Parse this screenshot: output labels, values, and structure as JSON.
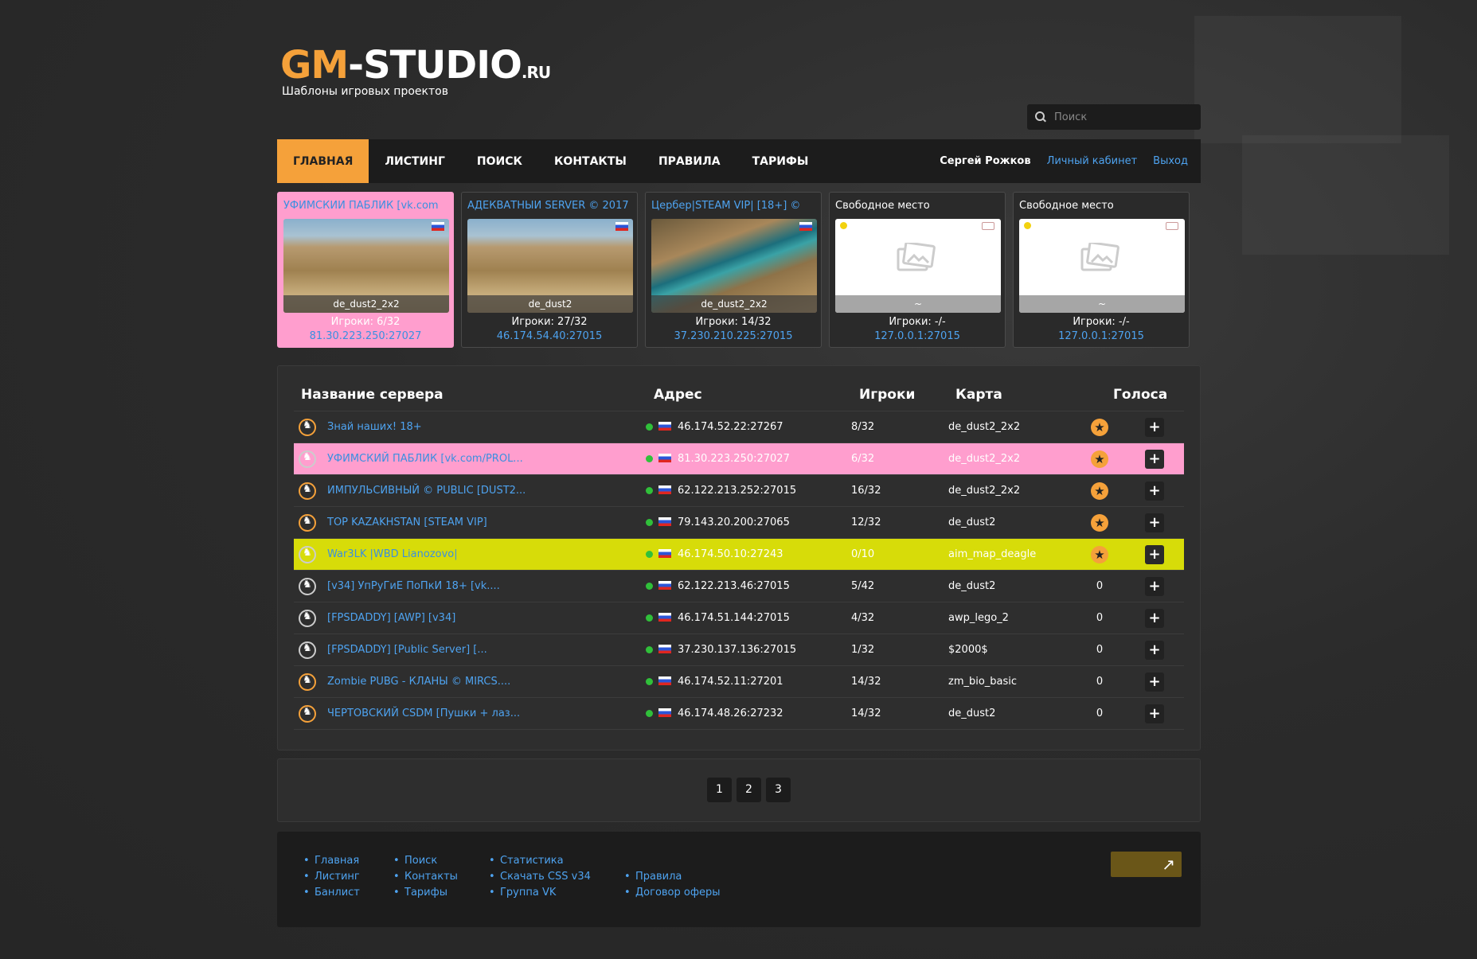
{
  "brand": {
    "logo_gm": "GM",
    "logo_studio": "-STUDIO",
    "logo_ru": ".RU",
    "tagline": "Шаблоны игровых проектов"
  },
  "search": {
    "placeholder": "Поиск"
  },
  "nav": {
    "items": [
      "ГЛАВНАЯ",
      "ЛИСТИНГ",
      "ПОИСК",
      "КОНТАКТЫ",
      "ПРАВИЛА",
      "ТАРИФЫ"
    ],
    "user": "Сергей Рожков",
    "cabinet": "Личный кабинет",
    "logout": "Выход"
  },
  "cards": [
    {
      "title": "УФИМСКИЙ ПАБЛИК [vk.com",
      "map": "de_dust2_2x2",
      "players": "Игроки: 6/32",
      "addr": "81.30.223.250:27027"
    },
    {
      "title": "АДЕКВАТНЫЙ SERVER © 2017",
      "map": "de_dust2",
      "players": "Игроки: 27/32",
      "addr": "46.174.54.40:27015"
    },
    {
      "title": "Цербер|STEAM VIP| [18+] ©",
      "map": "de_dust2_2x2",
      "players": "Игроки: 14/32",
      "addr": "37.230.210.225:27015"
    },
    {
      "title": "Свободное место",
      "map": "~",
      "players": "Игроки: -/-",
      "addr": "127.0.0.1:27015"
    },
    {
      "title": "Свободное место",
      "map": "~",
      "players": "Игроки: -/-",
      "addr": "127.0.0.1:27015"
    }
  ],
  "table": {
    "headers": {
      "name": "Название сервера",
      "addr": "Адрес",
      "players": "Игроки",
      "map": "Карта",
      "votes": "Голоса"
    },
    "rows": [
      {
        "name": "Знай наших! 18+",
        "addr": "46.174.52.22:27267",
        "players": "8/32",
        "map": "de_dust2_2x2",
        "votes": ""
      },
      {
        "name": "УФИМСКИЙ ПАБЛИК [vk.com/PROL...",
        "addr": "81.30.223.250:27027",
        "players": "6/32",
        "map": "de_dust2_2x2",
        "votes": ""
      },
      {
        "name": "ИМПУЛЬСИВНЫЙ © PUBLIC [DUST2...",
        "addr": "62.122.213.252:27015",
        "players": "16/32",
        "map": "de_dust2_2x2",
        "votes": ""
      },
      {
        "name": "TOP KAZAKHSTAN [STEAM VIP]",
        "addr": "79.143.20.200:27065",
        "players": "12/32",
        "map": "de_dust2",
        "votes": ""
      },
      {
        "name": "War3LK |WBD Lianozovo|",
        "addr": "46.174.50.10:27243",
        "players": "0/10",
        "map": "aim_map_deagle",
        "votes": ""
      },
      {
        "name": "[v34] УпРуГиЕ ПоПкИ 18+ [vk....",
        "addr": "62.122.213.46:27015",
        "players": "5/42",
        "map": "de_dust2",
        "votes": "0"
      },
      {
        "name": "[FPSDADDY] [AWP] [v34]",
        "addr": "46.174.51.144:27015",
        "players": "4/32",
        "map": "awp_lego_2",
        "votes": "0"
      },
      {
        "name": "[FPSDADDY] [Public Server] [...",
        "addr": "37.230.137.136:27015",
        "players": "1/32",
        "map": "$2000$",
        "votes": "0"
      },
      {
        "name": "Zombie PUBG - КЛАНЫ © MIRCS....",
        "addr": "46.174.52.11:27201",
        "players": "14/32",
        "map": "zm_bio_basic",
        "votes": "0"
      },
      {
        "name": "ЧЕРТОВСКИЙ CSDM [Пушки + лаз...",
        "addr": "46.174.48.26:27232",
        "players": "14/32",
        "map": "de_dust2",
        "votes": "0"
      }
    ]
  },
  "pagination": [
    "1",
    "2",
    "3"
  ],
  "footer": {
    "col1": [
      "Главная",
      "Листинг",
      "Банлист"
    ],
    "col2": [
      "Поиск",
      "Контакты",
      "Тарифы"
    ],
    "col3": [
      "Статистика",
      "Скачать CSS v34",
      "Группа VK"
    ],
    "col4": [
      "Правила",
      "Договор оферы"
    ],
    "up_icon": "↗"
  }
}
